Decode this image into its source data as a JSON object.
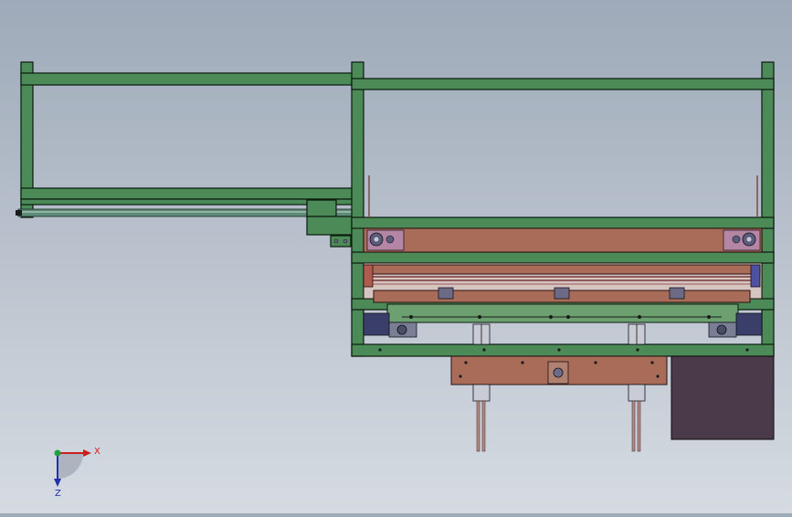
{
  "viewport": {
    "background_top": "#9eaab9",
    "background_bottom": "#d6dbe2"
  },
  "colors": {
    "frame": "#4c8a58",
    "frame_stroke": "#0b1a0d",
    "plate": "#a86c58",
    "plate_light": "#c49080",
    "rod": "#5e8a78",
    "motor": "#4a3a4a",
    "block": "#3a3f6a",
    "bolt": "#6d6a86",
    "axis_x": "#cc2020",
    "axis_y": "#20a040",
    "axis_z": "#2030b0"
  },
  "triad": {
    "x_label": "X",
    "z_label": "Z"
  }
}
